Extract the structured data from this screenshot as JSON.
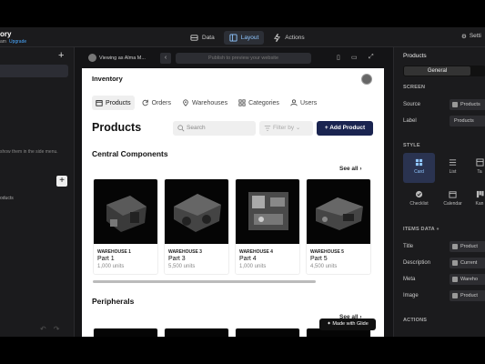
{
  "app": {
    "title": "ory",
    "plan": "am",
    "upgrade": "Upgrade"
  },
  "modes": [
    {
      "label": "Data",
      "icon": "database-icon"
    },
    {
      "label": "Layout",
      "icon": "layout-icon",
      "active": true
    },
    {
      "label": "Actions",
      "icon": "lightning-icon"
    }
  ],
  "settings_label": "Setti",
  "left_panel": {
    "hint": "show them in the side menu.",
    "item": "oducts"
  },
  "toolbar": {
    "viewing": "Viewing as Alma M...",
    "publish": "Publish to preview your website"
  },
  "preview": {
    "title": "Inventory",
    "tabs": [
      {
        "label": "Products",
        "icon": "box-icon",
        "active": true
      },
      {
        "label": "Orders",
        "icon": "refresh-icon"
      },
      {
        "label": "Warehouses",
        "icon": "location-pin-icon"
      },
      {
        "label": "Categories",
        "icon": "grid-icon"
      },
      {
        "label": "Users",
        "icon": "user-icon"
      }
    ],
    "heading": "Products",
    "search_placeholder": "Search",
    "filter_placeholder": "Filter by",
    "add_button": "Add Product",
    "sections": [
      {
        "title": "Central Components",
        "see_all": "See all",
        "cards": [
          {
            "warehouse": "WAREHOUSE 1",
            "name": "Part 1",
            "units": "1,000 units"
          },
          {
            "warehouse": "WAREHOUSE 3",
            "name": "Part 3",
            "units": "5,500 units"
          },
          {
            "warehouse": "WAREHOUSE 4",
            "name": "Part 4",
            "units": "1,000 units"
          },
          {
            "warehouse": "WAREHOUSE 5",
            "name": "Part 5",
            "units": "4,500 units"
          }
        ]
      },
      {
        "title": "Peripherals",
        "see_all": "See all"
      }
    ],
    "glide_badge": "Made with Glide"
  },
  "inspector": {
    "title": "Products",
    "tab_general": "General",
    "screen_heading": "SCREEN",
    "source_label": "Source",
    "source_value": "Products",
    "label_label": "Label",
    "label_value": "Products",
    "style_heading": "STYLE",
    "styles": [
      {
        "label": "Card",
        "icon": "card-icon",
        "selected": true
      },
      {
        "label": "List",
        "icon": "list-icon"
      },
      {
        "label": "Ta",
        "icon": "table-icon"
      },
      {
        "label": "Checklist",
        "icon": "checklist-icon"
      },
      {
        "label": "Calendar",
        "icon": "calendar-icon"
      },
      {
        "label": "Kan",
        "icon": "kanban-icon"
      }
    ],
    "items_data_heading": "ITEMS DATA",
    "fields": [
      {
        "label": "Title",
        "value": "Product"
      },
      {
        "label": "Description",
        "value": "Current"
      },
      {
        "label": "Meta",
        "value": "Wareho"
      },
      {
        "label": "Image",
        "value": "Product"
      }
    ],
    "actions_heading": "ACTIONS"
  }
}
